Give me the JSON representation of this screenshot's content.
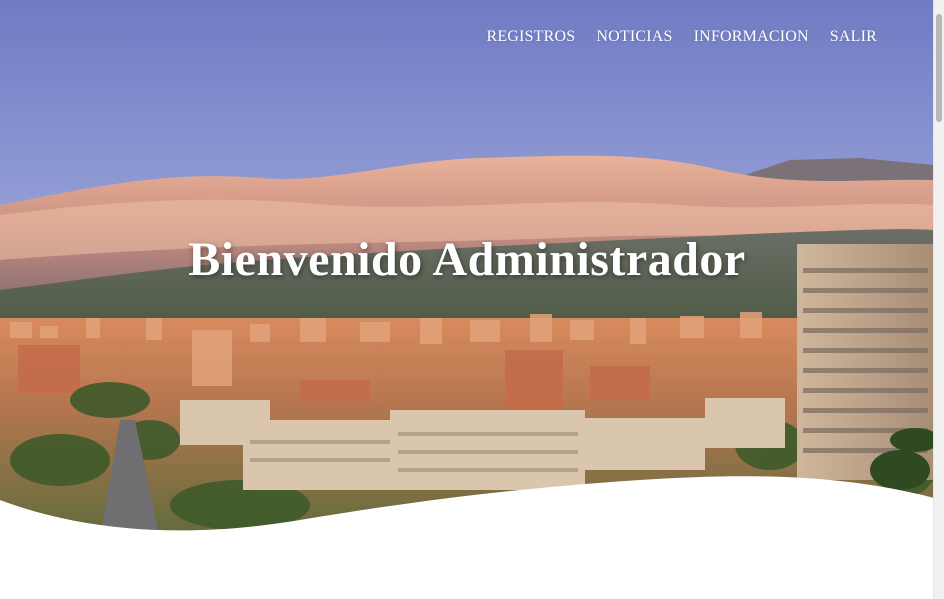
{
  "nav": {
    "items": [
      {
        "label": "REGISTROS"
      },
      {
        "label": "NOTICIAS"
      },
      {
        "label": "INFORMACION"
      },
      {
        "label": "SALIR"
      }
    ]
  },
  "hero": {
    "title": "Bienvenido Administrador",
    "image_icon": "city-skyline-photo"
  },
  "colors": {
    "nav_text": "#ffffff",
    "title_text": "#ffffff",
    "page_background": "#ffffff"
  }
}
